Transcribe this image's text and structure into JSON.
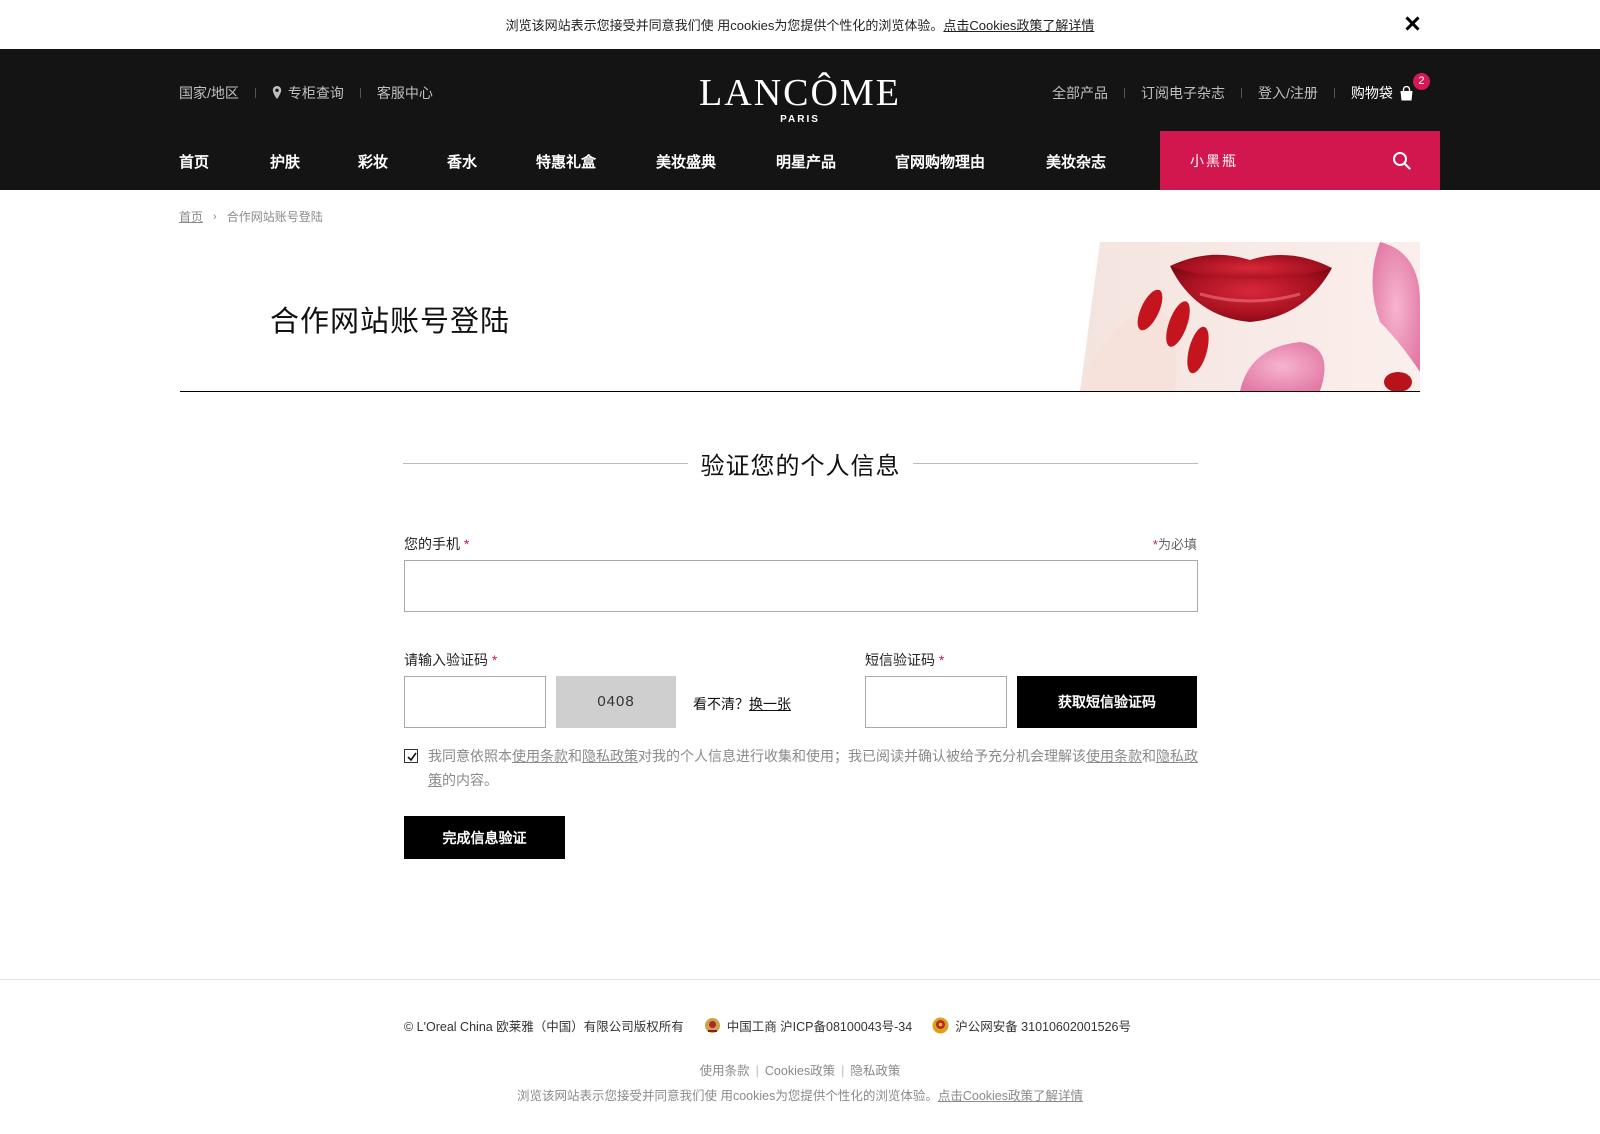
{
  "cookie_bar": {
    "text": "浏览该网站表示您接受并同意我们使 用cookies为您提供个性化的浏览体验。",
    "link": "点击Cookies政策了解详情"
  },
  "header": {
    "util_left": {
      "region": "国家/地区",
      "store_locator": "专柜查询",
      "service": "客服中心"
    },
    "logo": {
      "brand": "LANCÔME",
      "sub": "PARIS"
    },
    "util_right": {
      "all_products": "全部产品",
      "newsletter": "订阅电子杂志",
      "login": "登入/注册",
      "cart": "购物袋",
      "cart_count": "2"
    },
    "nav": [
      {
        "label": "首页"
      },
      {
        "label": "护肤"
      },
      {
        "label": "彩妆"
      },
      {
        "label": "香水"
      },
      {
        "label": "特惠礼盒"
      },
      {
        "label": "美妆盛典"
      },
      {
        "label": "明星产品"
      },
      {
        "label": "官网购物理由"
      },
      {
        "label": "美妆杂志"
      }
    ],
    "search": {
      "placeholder": "小黑瓶",
      "accent": "#d2174f"
    }
  },
  "breadcrumb": {
    "home": "首页",
    "current": "合作网站账号登陆"
  },
  "banner": {
    "title": "合作网站账号登陆"
  },
  "form": {
    "section_title": "验证您的个人信息",
    "phone_label": "您的手机",
    "required_mark": "*",
    "required_note": "为必填",
    "phone_value": "",
    "captcha_label": "请输入验证码",
    "captcha_value": "",
    "captcha_code": "0408",
    "refresh_text": "看不清？",
    "refresh_link": "换一张",
    "sms_label": "短信验证码",
    "sms_value": "",
    "sms_button": "获取短信验证码",
    "consent": {
      "checked": true,
      "t1": "我同意依照本",
      "terms": "使用条款",
      "and": "和",
      "privacy": "隐私政策",
      "t2": "对我的个人信息进行收集和使用；我已阅读并确认被给予充分机会理解该",
      "terms2": "使用条款",
      "and2": "和",
      "privacy2": "隐私政策",
      "t3": "的内容。"
    },
    "submit": "完成信息验证"
  },
  "footer": {
    "copyright": "© L'Oreal China 欧莱雅（中国）有限公司版权所有",
    "icp": "中国工商 沪ICP备08100043号-34",
    "police": "沪公网安备 31010602001526号",
    "links": [
      "使用条款",
      "Cookies政策",
      "隐私政策"
    ],
    "cookie_text": "浏览该网站表示您接受并同意我们使 用cookies为您提供个性化的浏览体验。",
    "cookie_link": "点击Cookies政策了解详情"
  }
}
